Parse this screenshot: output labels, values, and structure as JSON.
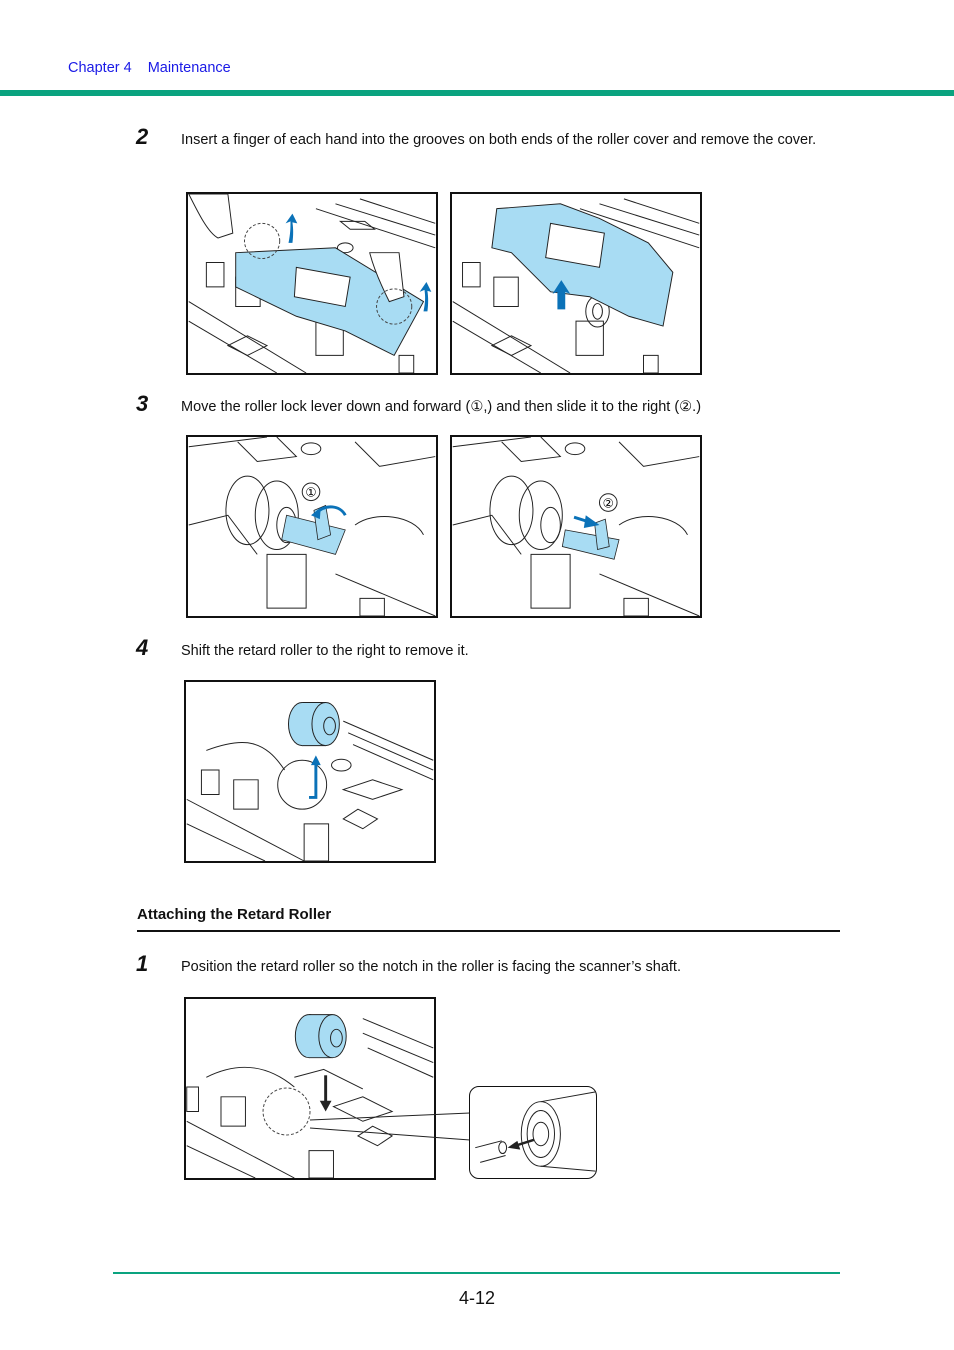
{
  "header": {
    "chapter": "Chapter 4",
    "section": "Maintenance"
  },
  "colors": {
    "accent_rule": "#0aa37f",
    "header_text": "#1a1ae6",
    "part_highlight": "#a8dcf3",
    "arrow": "#0b72b8"
  },
  "steps_removal": [
    {
      "number": "2",
      "text": "Insert a finger of each hand into the grooves on both ends of the roller cover and remove the cover.",
      "figures": [
        "fingers-lifting-roller-cover",
        "roller-cover-removed"
      ]
    },
    {
      "number": "3",
      "text": "Move the roller lock lever down and forward (①,) and then slide it to the right (②.)",
      "figures": [
        "lock-lever-down-forward",
        "lock-lever-slide-right"
      ],
      "figure_labels": [
        "①",
        "②"
      ]
    },
    {
      "number": "4",
      "text": "Shift the retard roller to the right to remove it.",
      "figures": [
        "retard-roller-removed"
      ]
    }
  ],
  "section": {
    "title": "Attaching the Retard Roller"
  },
  "steps_attach": [
    {
      "number": "1",
      "text": "Position the retard roller so the notch in the roller is facing the scanner’s shaft.",
      "figures": [
        "retard-roller-positioning",
        "notch-detail-callout"
      ]
    }
  ],
  "footer": {
    "page_number": "4-12"
  }
}
